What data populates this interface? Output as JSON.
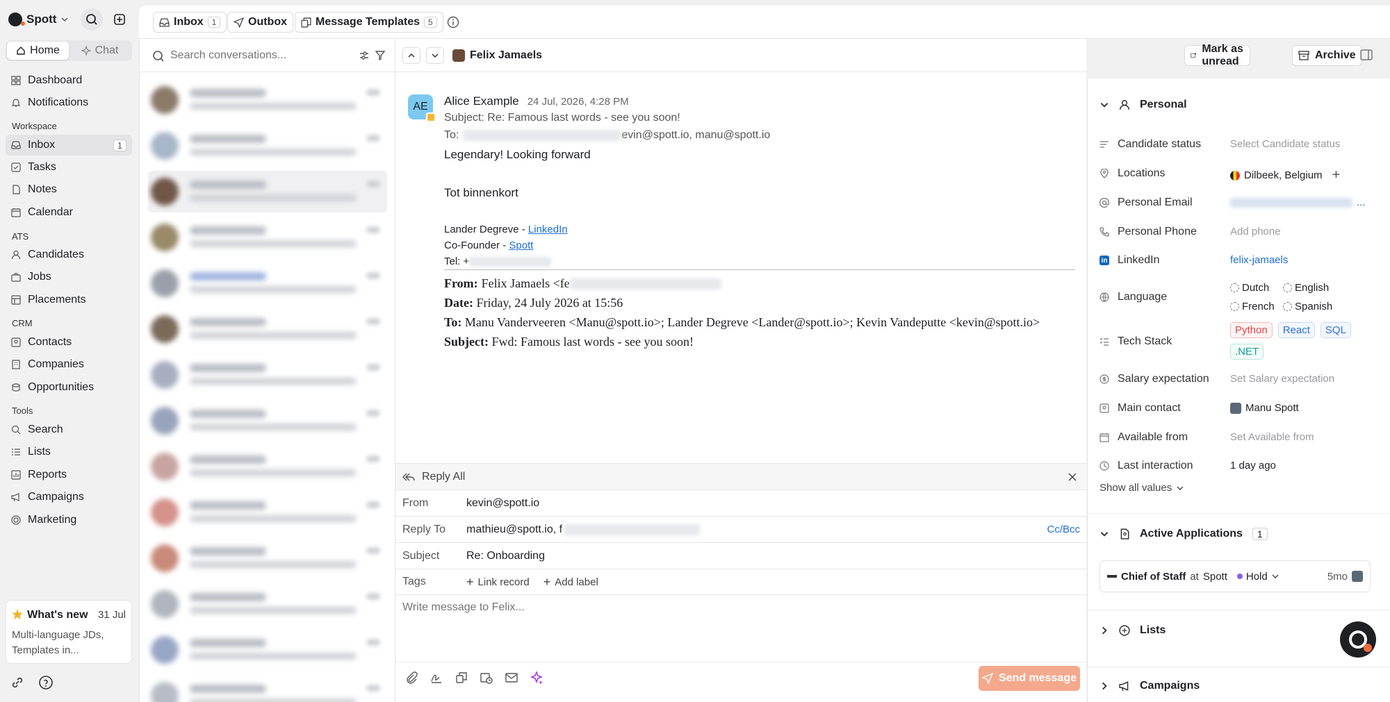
{
  "app": {
    "name": "Spott"
  },
  "sidebar": {
    "seg": {
      "home": "Home",
      "chat": "Chat"
    },
    "top_items": [
      {
        "label": "Dashboard",
        "icon": "dashboard-icon"
      },
      {
        "label": "Notifications",
        "icon": "bell-icon"
      }
    ],
    "sections": [
      {
        "title": "Workspace",
        "items": [
          {
            "label": "Inbox",
            "count": "1",
            "active": true
          },
          {
            "label": "Tasks"
          },
          {
            "label": "Notes"
          },
          {
            "label": "Calendar"
          }
        ]
      },
      {
        "title": "ATS",
        "items": [
          {
            "label": "Candidates"
          },
          {
            "label": "Jobs"
          },
          {
            "label": "Placements"
          }
        ]
      },
      {
        "title": "CRM",
        "items": [
          {
            "label": "Contacts"
          },
          {
            "label": "Companies"
          },
          {
            "label": "Opportunities"
          }
        ]
      },
      {
        "title": "Tools",
        "items": [
          {
            "label": "Search"
          },
          {
            "label": "Lists"
          },
          {
            "label": "Reports"
          },
          {
            "label": "Campaigns"
          },
          {
            "label": "Marketing"
          }
        ]
      }
    ],
    "whats_new": {
      "title": "What's new",
      "date": "31 Jul",
      "body": "Multi-language JDs, Templates in..."
    }
  },
  "topbar": {
    "tabs": [
      {
        "label": "Inbox",
        "count": "1"
      },
      {
        "label": "Outbox"
      },
      {
        "label": "Message Templates",
        "count": "5"
      }
    ]
  },
  "search": {
    "placeholder": "Search conversations..."
  },
  "thread": {
    "contact_name": "Felix Jamaels",
    "mark_unread": "Mark as unread",
    "archive": "Archive"
  },
  "email": {
    "avatar_initials": "AE",
    "sender": "Alice Example",
    "date": "24 Jul, 2026, 4:28 PM",
    "subject_line": "Subject: Re: Famous last words - see you soon!",
    "to_prefix": "To:",
    "to_visible": "evin@spott.io, manu@spott.io",
    "body_line1": "Legendary! Looking forward",
    "body_line2": "Tot binnenkort",
    "sig_name": "Lander Degreve  - ",
    "sig_linkedin": "LinkedIn",
    "sig_role": "Co-Founder - ",
    "sig_company": "Spott",
    "sig_tel": "Tel: +",
    "q_from_label": "From:",
    "q_from_val": "Felix Jamaels <fe",
    "q_date_label": "Date:",
    "q_date_val": "Friday, 24 July 2026 at 15:56",
    "q_to_label": "To:",
    "q_to_val": "Manu Vanderveeren <Manu@spott.io>; Lander Degreve <Lander@spott.io>; Kevin Vandeputte <kevin@spott.io>",
    "q_subject_label": "Subject:",
    "q_subject_val": "Fwd: Famous last words - see you soon!"
  },
  "reply": {
    "mode": "Reply All",
    "from_label": "From",
    "from_val": "kevin@spott.io",
    "replyto_label": "Reply To",
    "replyto_val": "mathieu@spott.io, f",
    "ccbcc": "Cc/Bcc",
    "subject_label": "Subject",
    "subject_val": "Re: Onboarding",
    "tags_label": "Tags",
    "link_record": "Link record",
    "add_label": "Add label",
    "placeholder": "Write message to Felix...",
    "send": "Send message"
  },
  "panel": {
    "personal_title": "Personal",
    "fields": {
      "candidate_status": {
        "label": "Candidate status",
        "value": "Select Candidate status"
      },
      "locations": {
        "label": "Locations",
        "value": "Dilbeek, Belgium"
      },
      "personal_email": {
        "label": "Personal Email",
        "value": "..."
      },
      "personal_phone": {
        "label": "Personal Phone",
        "value": "Add phone"
      },
      "linkedin": {
        "label": "LinkedIn",
        "value": "felix-jamaels"
      },
      "language": {
        "label": "Language",
        "options": [
          "Dutch",
          "English",
          "French",
          "Spanish"
        ]
      },
      "tech_stack": {
        "label": "Tech Stack",
        "chips": [
          "Python",
          "React",
          "SQL",
          ".NET"
        ]
      },
      "salary": {
        "label": "Salary expectation",
        "value": "Set Salary expectation"
      },
      "main_contact": {
        "label": "Main contact",
        "value": "Manu Spott"
      },
      "available_from": {
        "label": "Available from",
        "value": "Set Available from"
      },
      "last_interaction": {
        "label": "Last interaction",
        "value": "1 day ago"
      }
    },
    "show_all": "Show all values",
    "active_apps": {
      "title": "Active Applications",
      "count": "1",
      "item": {
        "role": "Chief of Staff",
        "at": "at",
        "company": "Spott",
        "status": "Hold",
        "age": "5mo"
      }
    },
    "lists_title": "Lists",
    "campaigns_title": "Campaigns"
  },
  "colors": {
    "accent_link": "#1f6fd6",
    "send_btn": "#f4a88c",
    "chip_python": "#e04848",
    "chip_react": "#2f6fe0",
    "chip_sql": "#2f6fe0",
    "chip_net": "#16a08a"
  }
}
